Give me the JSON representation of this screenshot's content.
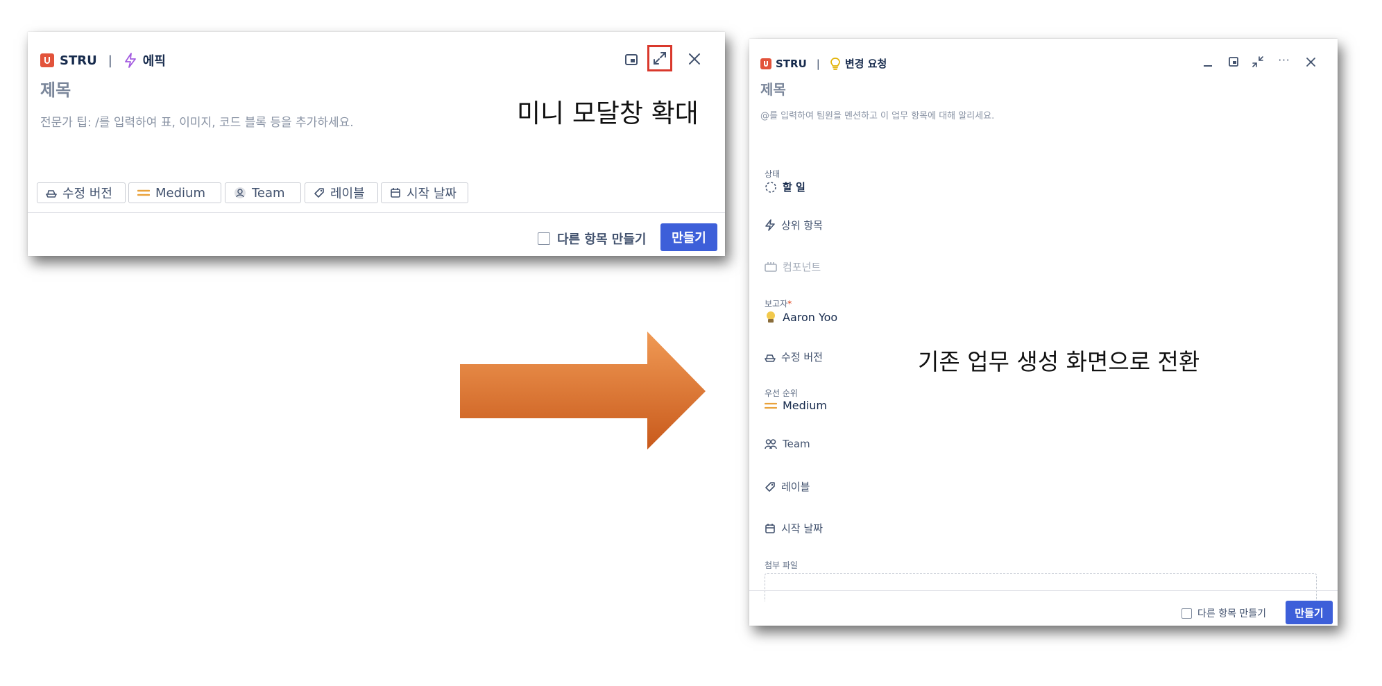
{
  "mini_modal": {
    "project": "STRU",
    "issue_type": "에픽",
    "title_placeholder": "제목",
    "description_hint": "전문가 팁: /를 입력하여 표, 이미지, 코드 블록 등을 추가하세요.",
    "chips": {
      "fix_version": "수정 버전",
      "priority": "Medium",
      "team": "Team",
      "labels": "레이블",
      "start_date": "시작 날짜"
    },
    "create_another": "다른 항목 만들기",
    "create_button": "만들기",
    "annotation": "미니 모달창 확대"
  },
  "full_modal": {
    "project": "STRU",
    "issue_type": "변경 요청",
    "title_placeholder": "제목",
    "description_hint": "@를 입력하여 팀원을 멘션하고 이 업무 항목에 대해 알리세요.",
    "fields": {
      "status_label": "상태",
      "status_value": "할 일",
      "parent": "상위 항목",
      "components": "컴포넌트",
      "reporter_label": "보고자",
      "reporter_required": "*",
      "reporter_value": "Aaron Yoo",
      "fix_version": "수정 버전",
      "priority_label": "우선 순위",
      "priority_value": "Medium",
      "team": "Team",
      "labels": "레이블",
      "start_date": "시작 날짜",
      "attachment_label": "첨부 파일"
    },
    "more_menu": "···",
    "create_another": "다른 항목 만들기",
    "create_button": "만들기",
    "annotation": "기존 업무 생성 화면으로 전환"
  },
  "colors": {
    "primary_button": "#3d5fd9",
    "expand_highlight": "#d9382c",
    "epic_icon": "#a35be0",
    "change_request_icon": "#e2b203",
    "priority_medium": "#e9a23b",
    "arrow_gradient_top": "#f09a55",
    "arrow_gradient_bottom": "#c8591b"
  },
  "icons": {
    "expand": "expand-icon",
    "collapse": "collapse-icon",
    "picture_in_picture": "pip-icon",
    "close": "close-icon",
    "minimize": "minimize-icon"
  }
}
